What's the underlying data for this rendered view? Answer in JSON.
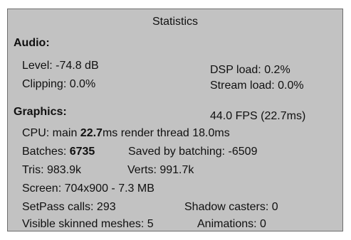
{
  "window": {
    "title": "Statistics"
  },
  "audio": {
    "header": "Audio:",
    "level": "Level: -74.8 dB",
    "clipping": "Clipping: 0.0%",
    "dsp_load": "DSP load: 0.2%",
    "stream_load": "Stream load: 0.0%"
  },
  "graphics": {
    "header": "Graphics:",
    "fps": "44.0 FPS (22.7ms)",
    "cpu_prefix": "CPU: main ",
    "cpu_main_value": "22.7",
    "cpu_suffix": "ms  render thread 18.0ms",
    "batches_prefix": "Batches: ",
    "batches_value": "6735",
    "saved_by_batching": "Saved by batching: -6509",
    "tris": "Tris: 983.9k",
    "verts": "Verts: 991.7k",
    "screen": "Screen: 704x900 - 7.3 MB",
    "setpass_calls": "SetPass calls: 293",
    "shadow_casters": "Shadow casters: 0",
    "visible_skinned_meshes": "Visible skinned meshes: 5",
    "animations": "Animations: 0"
  },
  "colors": {
    "panel_background": "#c2c2c2",
    "panel_border": "#6e6e6e",
    "text": "#101010"
  }
}
